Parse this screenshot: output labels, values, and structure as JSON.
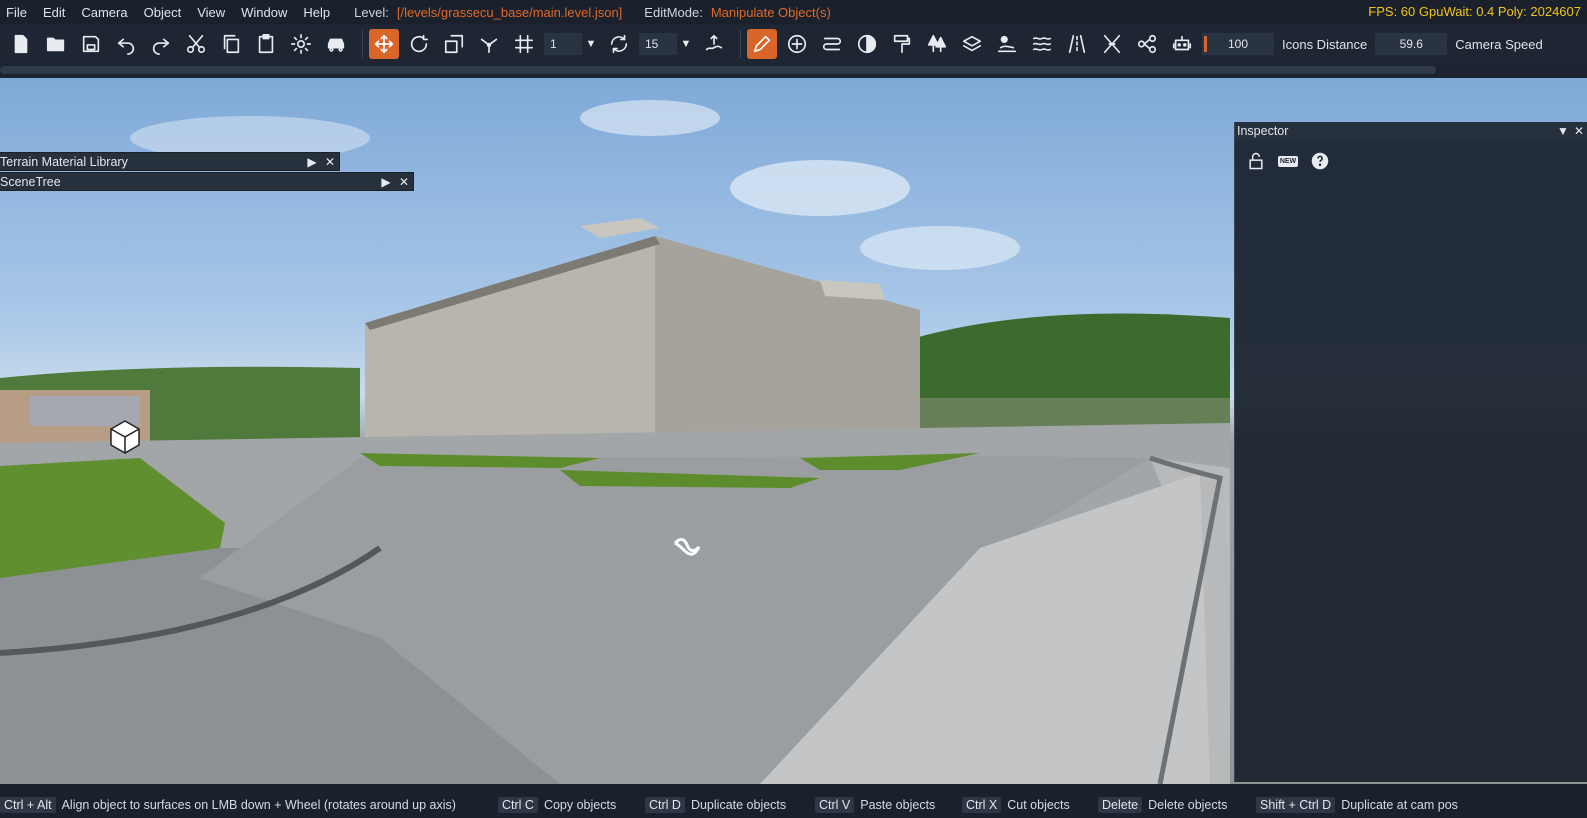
{
  "menu": {
    "items": [
      "File",
      "Edit",
      "Camera",
      "Object",
      "View",
      "Window",
      "Help"
    ],
    "level_label": "Level:",
    "level_value": "[/levels/grassecu_base/main.level.json]",
    "editmode_label": "EditMode:",
    "editmode_value": "Manipulate Object(s)",
    "stats": "FPS: 60  GpuWait: 0.4  Poly: 2024607"
  },
  "toolbar": {
    "snap_value": "1",
    "rotate_snap_value": "15",
    "icons_distance_value": "100",
    "icons_distance_label": "Icons Distance",
    "camera_speed_value": "59.6",
    "camera_speed_label": "Camera Speed"
  },
  "panels": {
    "terrain_material_library": "Terrain Material Library",
    "scene_tree": "SceneTree",
    "inspector": "Inspector"
  },
  "statusbar": {
    "hints": [
      {
        "key": "Ctrl + Alt",
        "text": "Align object to surfaces on LMB down + Wheel (rotates around up axis)"
      },
      {
        "key": "Ctrl C",
        "text": "Copy objects"
      },
      {
        "key": "Ctrl D",
        "text": "Duplicate objects"
      },
      {
        "key": "Ctrl V",
        "text": "Paste objects"
      },
      {
        "key": "Ctrl X",
        "text": "Cut objects"
      },
      {
        "key": "Delete",
        "text": "Delete objects"
      },
      {
        "key": "Shift + Ctrl D",
        "text": "Duplicate at cam pos"
      }
    ]
  },
  "colors": {
    "accent": "#d9652a",
    "stats": "#f0c419",
    "level": "#e06a2a"
  }
}
